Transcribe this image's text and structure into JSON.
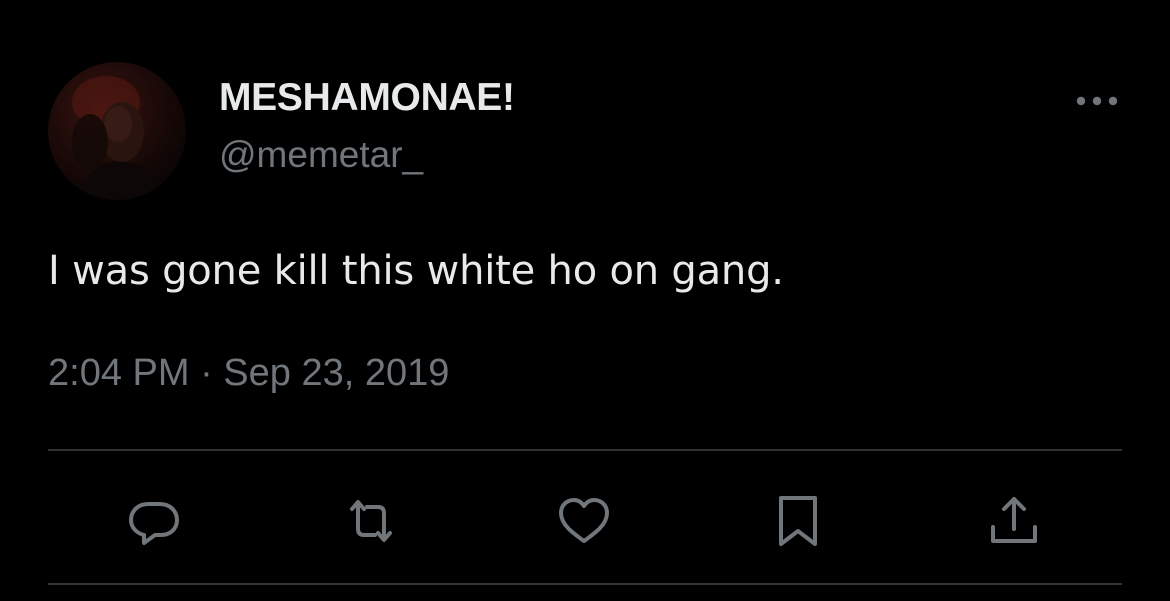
{
  "tweet": {
    "author": {
      "display_name": "MESHAMONAE!",
      "handle": "@memetar_"
    },
    "text": "I was gone kill this white ho on gang.",
    "timestamp": "2:04 PM · Sep 23, 2019"
  },
  "icons": {
    "more": "more-horizontal-icon",
    "reply": "reply-icon",
    "retweet": "retweet-icon",
    "like": "heart-icon",
    "bookmark": "bookmark-icon",
    "share": "share-icon"
  },
  "colors": {
    "background": "#000000",
    "primary_text": "#e7e9ea",
    "secondary_text": "#71767b",
    "divider": "#2f3336"
  }
}
